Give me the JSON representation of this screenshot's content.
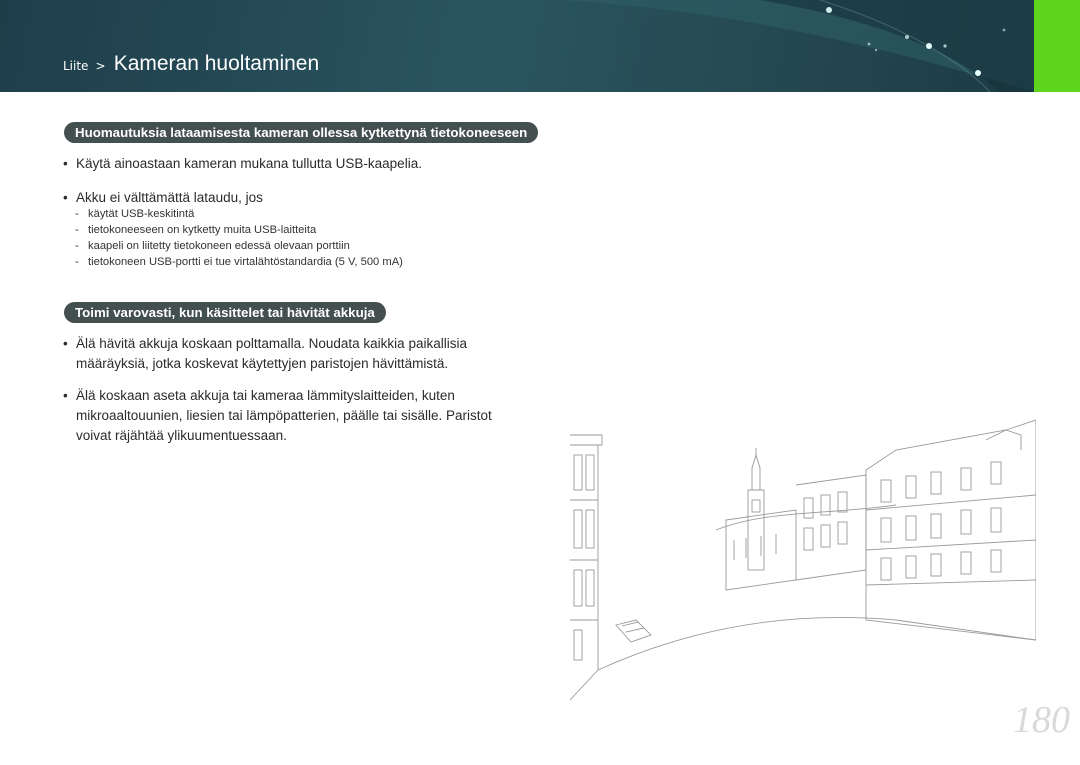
{
  "header": {
    "breadcrumb_parent": "Liite",
    "breadcrumb_separator": ">",
    "title": "Kameran huoltaminen"
  },
  "section1": {
    "heading": "Huomautuksia lataamisesta kameran ollessa kytkettynä tietokoneeseen",
    "bullets": [
      "Käytä ainoastaan kameran mukana tullutta USB-kaapelia.",
      "Akku ei välttämättä lataudu, jos"
    ],
    "subitems": [
      "käytät USB-keskitintä",
      "tietokoneeseen on kytketty muita USB-laitteita",
      "kaapeli on liitetty tietokoneen edessä olevaan porttiin",
      "tietokoneen USB-portti ei tue virtalähtöstandardia (5 V, 500 mA)"
    ]
  },
  "section2": {
    "heading": "Toimi varovasti, kun käsittelet tai hävität akkuja",
    "bullets": [
      "Älä hävitä akkuja koskaan polttamalla. Noudata kaikkia paikallisia määräyksiä, jotka koskevat käytettyjen paristojen hävittämistä.",
      "Älä koskaan aseta akkuja tai kameraa lämmityslaitteiden, kuten mikroaaltouunien, liesien tai lämpöpatterien, päälle tai sisälle. Paristot voivat räjähtää ylikuumentuessaan."
    ]
  },
  "bullet_symbol": "•",
  "dash_symbol": "-",
  "page_number": "180",
  "colors": {
    "header_bg": "#24474f",
    "accent_green": "#5fd41c",
    "pill_bg": "#44504f",
    "page_number": "#d9d9d9"
  }
}
